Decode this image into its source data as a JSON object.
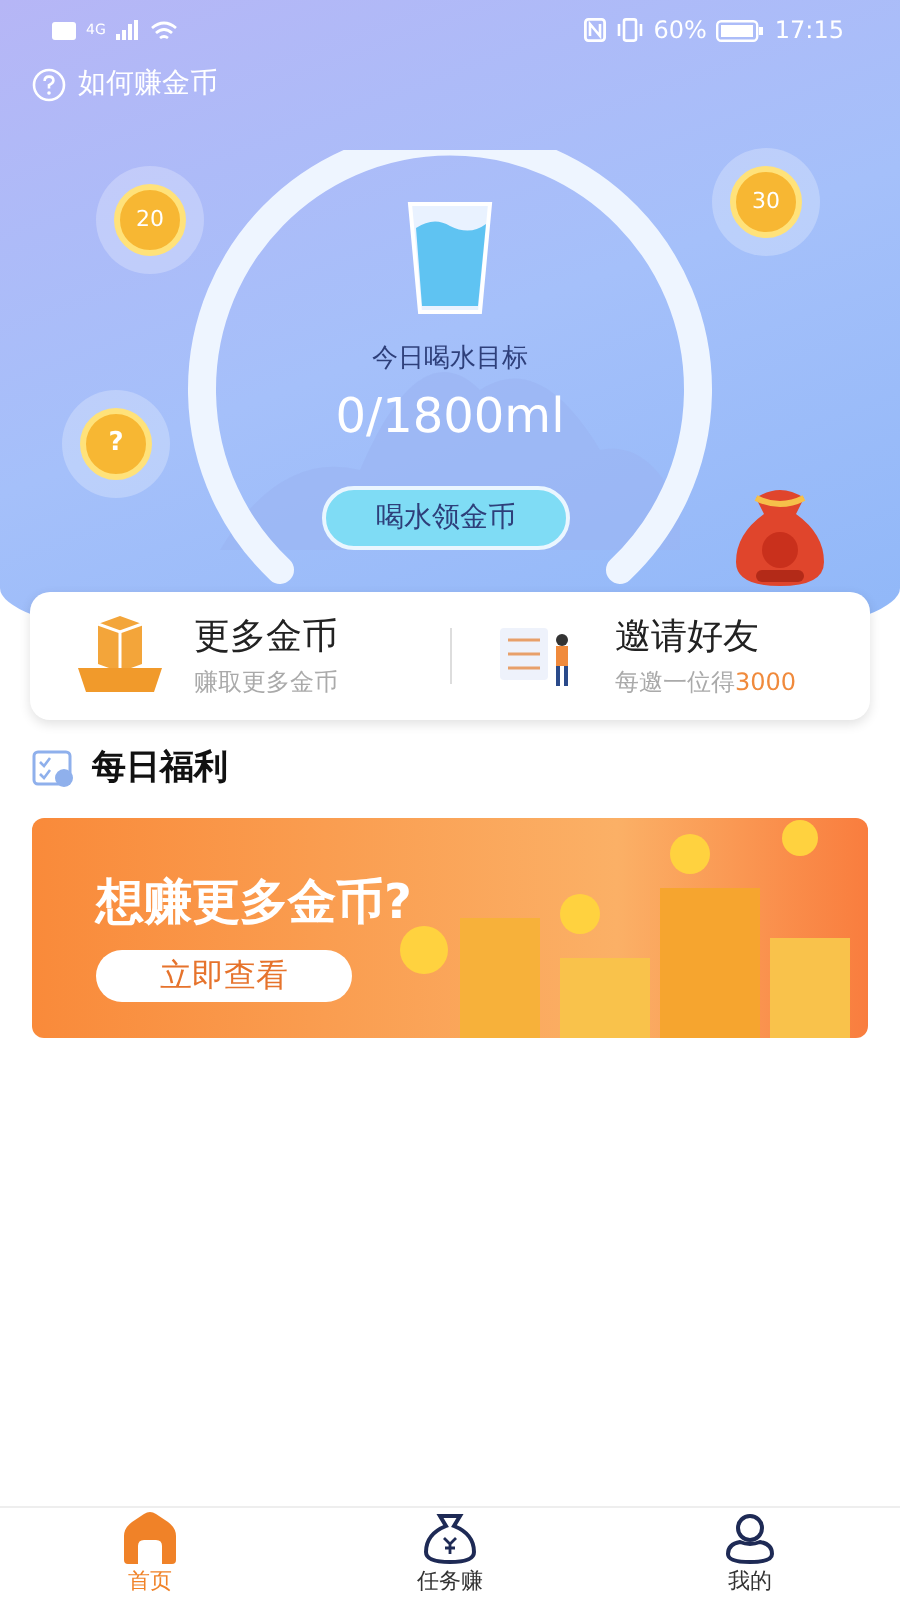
{
  "status_bar": {
    "network": "4G",
    "battery_percent": "60%",
    "time": "17:15"
  },
  "help_link": "如何赚金币",
  "coins": [
    {
      "label": "20",
      "kind": "value"
    },
    {
      "label": "30",
      "kind": "value"
    },
    {
      "label": "?",
      "kind": "mystery"
    }
  ],
  "water": {
    "caption": "今日喝水目标",
    "amount": "0/1800ml",
    "button": "喝水领金币"
  },
  "shortcuts": [
    {
      "kind": "coins",
      "title": "更多金币",
      "subtitle": "赚取更多金币"
    },
    {
      "kind": "invite",
      "title": "邀请好友",
      "subtitle": "每邀一位得",
      "highlight": "3000"
    }
  ],
  "section_title": "每日福利",
  "banner": {
    "headline": "想赚更多金币?",
    "button": "立即查看"
  },
  "tabs": [
    {
      "label": "首页",
      "kind": "home",
      "selected": true
    },
    {
      "label": "任务赚",
      "kind": "moneybag",
      "selected": false
    },
    {
      "label": "我的",
      "kind": "person",
      "selected": false
    }
  ]
}
